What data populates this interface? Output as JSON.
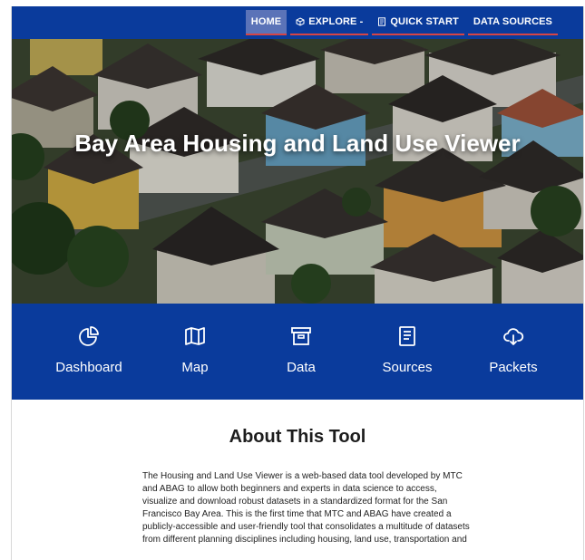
{
  "nav": {
    "items": [
      {
        "label": "HOME",
        "active": true,
        "icon": ""
      },
      {
        "label": "EXPLORE -",
        "active": false,
        "icon": "cube-icon"
      },
      {
        "label": "QUICK START",
        "active": false,
        "icon": "document-icon"
      },
      {
        "label": "DATA SOURCES",
        "active": false,
        "icon": ""
      }
    ]
  },
  "hero": {
    "title": "Bay Area Housing and Land Use Viewer"
  },
  "tiles": [
    {
      "label": "Dashboard",
      "icon": "pie-chart-icon"
    },
    {
      "label": "Map",
      "icon": "map-icon"
    },
    {
      "label": "Data",
      "icon": "archive-box-icon"
    },
    {
      "label": "Sources",
      "icon": "document-list-icon"
    },
    {
      "label": "Packets",
      "icon": "cloud-download-icon"
    }
  ],
  "about": {
    "title": "About This Tool",
    "body": "The Housing and Land Use Viewer is a web-based data tool developed by MTC and ABAG to allow both beginners and experts in data science to access, visualize and download robust datasets in a standardized format for the San Francisco Bay Area. This is the first time that MTC and ABAG have created a publicly-accessible and user-friendly tool that consolidates a multitude of datasets from different planning disciplines including housing, land use, transportation and"
  },
  "colors": {
    "brand_blue": "#0a3b9c",
    "active_nav": "#5b73b8",
    "nav_underline": "#d64545"
  }
}
